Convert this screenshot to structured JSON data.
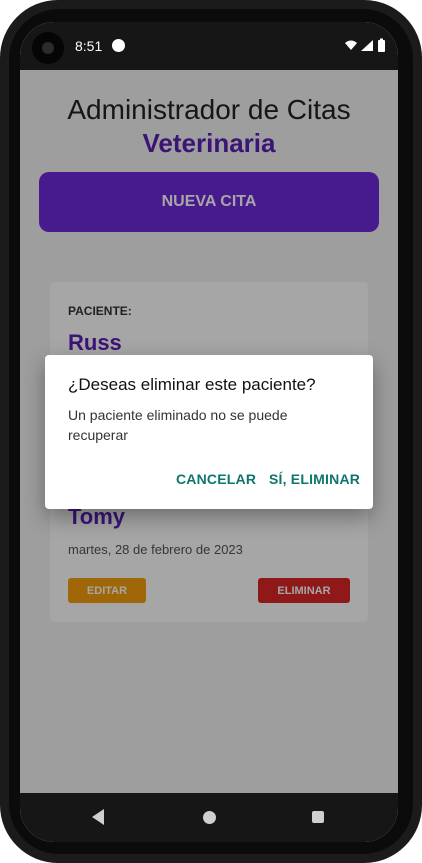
{
  "statusbar": {
    "time": "8:51",
    "icons": [
      "data-saver-icon",
      "wifi-icon",
      "signal-icon",
      "battery-icon"
    ]
  },
  "app": {
    "title_line1": "Administrador de Citas",
    "title_line2": "Veterinaria",
    "new_appointment_button": "NUEVA CITA"
  },
  "card": {
    "label": "PACIENTE:",
    "patient_name_top": "Russ",
    "patient_name": "Tomy",
    "date": "martes, 28 de febrero de 2023",
    "edit_button": "EDITAR",
    "delete_button": "ELIMINAR"
  },
  "dialog": {
    "title": "¿Deseas eliminar este paciente?",
    "message": "Un paciente eliminado no se puede recuperar",
    "cancel": "CANCELAR",
    "confirm": "SÍ, ELIMINAR"
  },
  "colors": {
    "primary": "#6d28d9",
    "title_accent": "#5b21b6",
    "edit": "#f59e0b",
    "delete": "#dc2626",
    "dialog_action": "#0f766e"
  },
  "navbar": {
    "icons": [
      "back-icon",
      "home-icon",
      "recents-icon"
    ]
  }
}
